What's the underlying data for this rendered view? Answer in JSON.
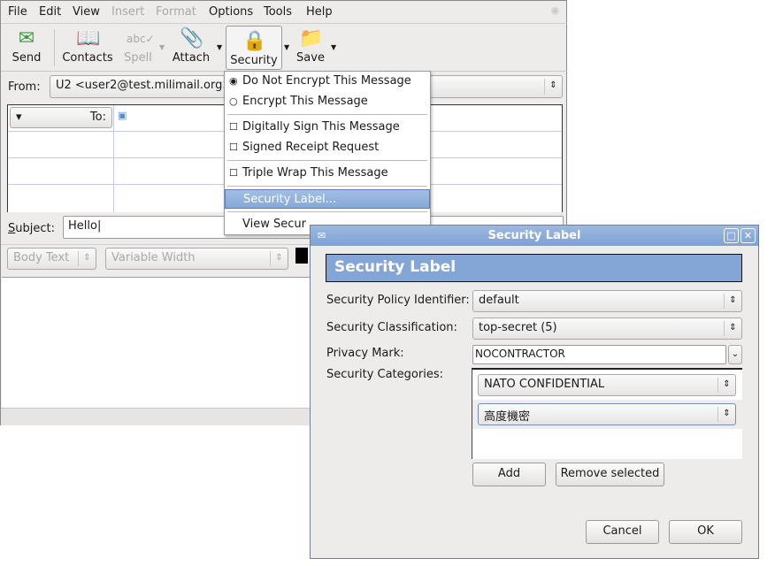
{
  "menubar": [
    "File",
    "Edit",
    "View",
    "Insert",
    "Format",
    "Options",
    "Tools",
    "Help"
  ],
  "menubar_disabled": [
    "Insert",
    "Format"
  ],
  "toolbar": {
    "send": "Send",
    "contacts": "Contacts",
    "spell": "Spell",
    "attach": "Attach",
    "security": "Security",
    "save": "Save"
  },
  "from": {
    "label": "From:",
    "value": "U2 <user2@test.milimail.org>"
  },
  "address": {
    "type": "To:"
  },
  "subject": {
    "label": "Subject:",
    "value": "Hello"
  },
  "format": {
    "paragraph": "Body Text",
    "font": "Variable Width"
  },
  "security_menu": {
    "items": [
      "Do Not Encrypt This Message",
      "Encrypt This Message",
      "Digitally Sign This Message",
      "Signed Receipt Request",
      "Triple Wrap This Message",
      "Security Label...",
      "View Secur"
    ],
    "selected": "Do Not Encrypt This Message",
    "highlighted": "Security Label..."
  },
  "dialog": {
    "title": "Security Label",
    "header": "Security Label",
    "policy_label": "Security Policy Identifier:",
    "policy_value": "default",
    "class_label": "Security Classification:",
    "class_value": "top-secret (5)",
    "privacy_label": "Privacy Mark:",
    "privacy_value": "NOCONTRACTOR",
    "categories_label": "Security Categories:",
    "categories": [
      "NATO CONFIDENTIAL",
      "高度機密"
    ],
    "add": "Add",
    "remove": "Remove selected",
    "cancel": "Cancel",
    "ok": "OK"
  },
  "colors": {
    "accent": "#84a6d6",
    "highlight": "#8fb0dc"
  }
}
